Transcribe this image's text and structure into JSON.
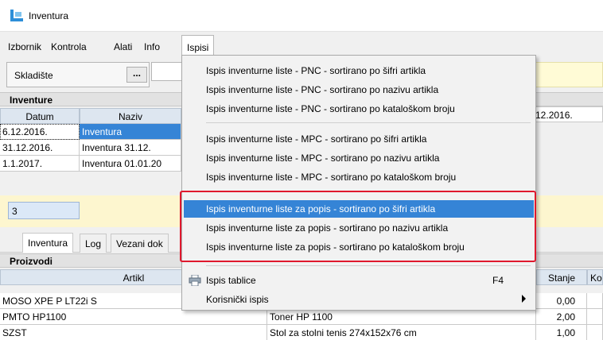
{
  "window": {
    "title": "Inventura"
  },
  "menubar": {
    "items": [
      {
        "label": "Izbornik"
      },
      {
        "label": "Kontrola"
      },
      {
        "label": "Alati"
      },
      {
        "label": "Info"
      },
      {
        "label": "Ispisi"
      }
    ]
  },
  "filter": {
    "label": "Skladište",
    "dots": "...",
    "right_date": "6.12.2016."
  },
  "inventure": {
    "header": "Inventure",
    "columns": [
      "Datum",
      "Naziv"
    ],
    "rows": [
      {
        "datum": "6.12.2016.",
        "naziv": "Inventura"
      },
      {
        "datum": "31.12.2016.",
        "naziv": "Inventura 31.12."
      },
      {
        "datum": "1.1.2017.",
        "naziv": "Inventura 01.01.20"
      }
    ],
    "count": "3"
  },
  "tabs": [
    {
      "label": "Inventura"
    },
    {
      "label": "Log"
    },
    {
      "label": "Vezani dok"
    }
  ],
  "proizvodi": {
    "header": "Proizvodi",
    "columns": [
      "Artikl",
      "Stanje",
      "Ko"
    ],
    "rows": [
      {
        "artikl": "MOSO XPE P LT22i S",
        "naziv": "",
        "stanje": "0,00"
      },
      {
        "artikl": "PMTO HP1100",
        "naziv": "Toner HP 1100",
        "stanje": "2,00"
      },
      {
        "artikl": "SZST",
        "naziv": "Stol za stolni tenis 274x152x76 cm",
        "stanje": "1,00"
      }
    ]
  },
  "dropdown": {
    "items": [
      "Ispis inventurne liste - PNC - sortirano po šifri artikla",
      "Ispis inventurne liste - PNC - sortirano po nazivu artikla",
      "Ispis inventurne liste - PNC - sortirano po kataloškom broju",
      "Ispis inventurne liste - MPC - sortirano po šifri artikla",
      "Ispis inventurne liste - MPC - sortirano po nazivu artikla",
      "Ispis inventurne liste - MPC - sortirano po kataloškom broju",
      "Ispis inventurne liste za popis - sortirano po šifri artikla",
      "Ispis inventurne liste za popis - sortirano po nazivu artikla",
      "Ispis inventurne liste za popis - sortirano po kataloškom broju"
    ],
    "print_table": {
      "label": "Ispis tablice",
      "shortcut": "F4"
    },
    "custom_print": {
      "label": "Korisnički ispis"
    }
  },
  "colors": {
    "selection": "#3584d6",
    "highlight_frame": "#e0182d",
    "count_area": "#fdf6cf"
  }
}
